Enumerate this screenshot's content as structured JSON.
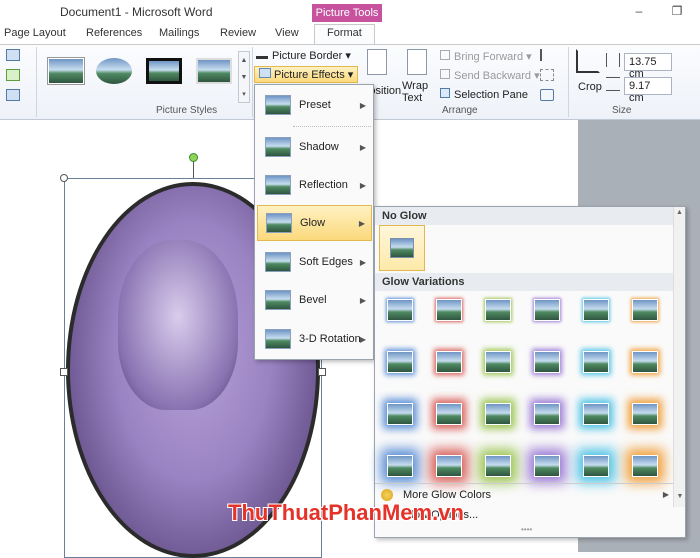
{
  "window": {
    "title": "Document1 - Microsoft Word",
    "context_tab": "Picture Tools",
    "min_icon": "minimize-icon",
    "restore_icon": "restore-icon"
  },
  "tabs": [
    "Page Layout",
    "References",
    "Mailings",
    "Review",
    "View",
    "Format"
  ],
  "ribbon": {
    "picture_styles_label": "Picture Styles",
    "picture_border": "Picture Border",
    "picture_effects": "Picture Effects",
    "position": "Position",
    "wrap_text": "Wrap Text",
    "bring_forward": "Bring Forward",
    "send_backward": "Send Backward",
    "selection_pane": "Selection Pane",
    "arrange_label": "Arrange",
    "crop": "Crop",
    "height": "13.75 cm",
    "width": "9.17 cm",
    "size_label": "Size"
  },
  "effects_menu": [
    "Preset",
    "Shadow",
    "Reflection",
    "Glow",
    "Soft Edges",
    "Bevel",
    "3-D Rotation"
  ],
  "glow": {
    "no_glow": "No Glow",
    "variations": "Glow Variations",
    "more_colors": "More Glow Colors",
    "options": "Glow Options...",
    "colors": [
      "#5b8fd6",
      "#d9605a",
      "#9cc553",
      "#9c7bd4",
      "#4fc3e6",
      "#f0a03c"
    ]
  },
  "watermark": "ThuThuatPhanMem.vn"
}
